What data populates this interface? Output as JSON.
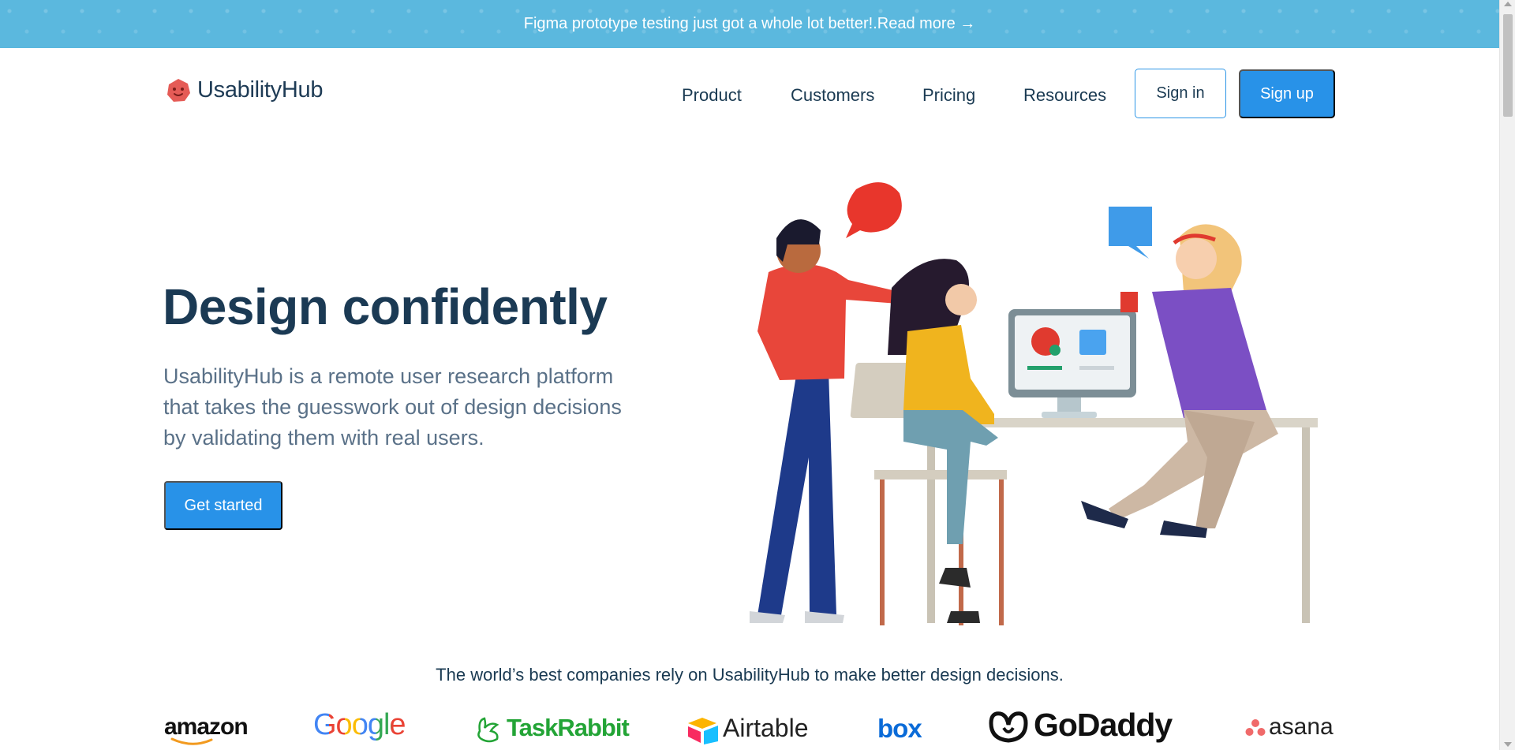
{
  "banner": {
    "text": "Figma prototype testing just got a whole lot better!.",
    "link": "Read more →"
  },
  "header": {
    "logo_text": "UsabilityHub",
    "nav": [
      "Product",
      "Customers",
      "Pricing",
      "Resources"
    ],
    "signin": "Sign in",
    "signup": "Sign up"
  },
  "hero": {
    "title": "Design confidently",
    "description": "UsabilityHub is a remote user research platform that takes the guesswork out of design decisions by validating them with real users.",
    "cta": "Get started"
  },
  "companies": {
    "tagline": "The world’s best companies rely on UsabilityHub to make better design decisions.",
    "logos": [
      "amazon",
      "Google",
      "TaskRabbit",
      "Airtable",
      "box",
      "GoDaddy",
      "asana"
    ]
  },
  "colors": {
    "banner": "#5bb8de",
    "primary": "#2892e8",
    "heading": "#1b3a54",
    "body_text": "#5a7188"
  }
}
